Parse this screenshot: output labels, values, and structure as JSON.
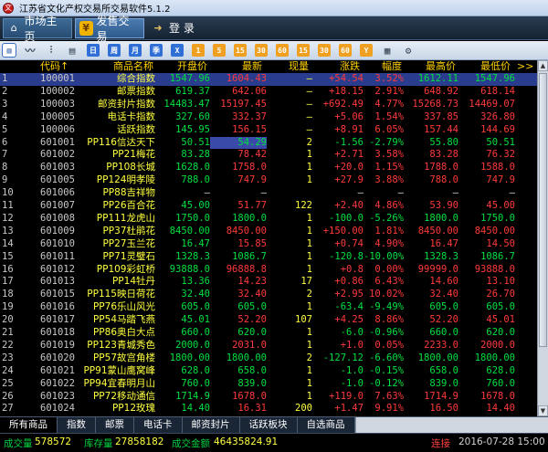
{
  "window": {
    "title": "江苏省文化产权交易所交易软件5.1.2",
    "logo": "文"
  },
  "top_tabs": [
    {
      "label": "市场主页",
      "icon": "home-icon"
    },
    {
      "label": "发售交易",
      "icon": "yen-icon"
    },
    {
      "label": "登 录",
      "icon": "login-icon"
    }
  ],
  "toolbar": {
    "buttons": [
      {
        "name": "kline-chart-icon",
        "glyph": "▥",
        "style": "sel"
      },
      {
        "name": "line-chart-icon",
        "glyph": "〰",
        "style": "plain"
      },
      {
        "name": "candles-icon",
        "glyph": "⫶",
        "style": "plain"
      },
      {
        "name": "list-icon",
        "glyph": "▤",
        "style": "plain"
      },
      {
        "name": "day-button",
        "glyph": "日",
        "style": "blue"
      },
      {
        "name": "week-button",
        "glyph": "周",
        "style": "blue"
      },
      {
        "name": "month-button",
        "glyph": "月",
        "style": "blue"
      },
      {
        "name": "season-button",
        "glyph": "季",
        "style": "blue"
      },
      {
        "name": "x-button",
        "glyph": "X",
        "style": "blue"
      },
      {
        "name": "period-1-button",
        "glyph": "1",
        "style": "orange"
      },
      {
        "name": "period-5-button",
        "glyph": "5",
        "style": "orange"
      },
      {
        "name": "period-15-button",
        "glyph": "15",
        "style": "orange"
      },
      {
        "name": "period-30-button",
        "glyph": "30",
        "style": "orange"
      },
      {
        "name": "period-60-button",
        "glyph": "60",
        "style": "orange"
      },
      {
        "name": "period-15b-button",
        "glyph": "15",
        "style": "orange"
      },
      {
        "name": "period-30b-button",
        "glyph": "30",
        "style": "orange"
      },
      {
        "name": "period-60b-button",
        "glyph": "60",
        "style": "orange"
      },
      {
        "name": "y-button",
        "glyph": "Y",
        "style": "orange"
      },
      {
        "name": "sheet-icon",
        "glyph": "▦",
        "style": "plain"
      },
      {
        "name": "gear-icon",
        "glyph": "⚙",
        "style": "plain"
      }
    ]
  },
  "columns": {
    "code": "代码↑",
    "name": "商品名称",
    "open": "开盘价",
    "last": "最新",
    "vol": "现量",
    "chg": "涨跌",
    "pct": "幅度",
    "high": "最高价",
    "low": "最低价",
    "more": ">>"
  },
  "colors": {
    "up": "#ff3a3a",
    "down": "#00e040",
    "flat": "#d8d8d8",
    "header": "#ffd000"
  },
  "rows": [
    [
      "1",
      "100001",
      "综合指数",
      "1547.96",
      "1604.43",
      "—",
      "+54.54",
      "3.52%",
      "1612.11",
      "1547.96",
      "u"
    ],
    [
      "2",
      "100002",
      "邮票指数",
      "619.37",
      "642.06",
      "—",
      "+18.15",
      "2.91%",
      "648.92",
      "618.14",
      "u"
    ],
    [
      "3",
      "100003",
      "邮资封片指数",
      "14483.47",
      "15197.45",
      "—",
      "+692.49",
      "4.77%",
      "15268.73",
      "14469.07",
      "u"
    ],
    [
      "4",
      "100005",
      "电话卡指数",
      "327.60",
      "332.37",
      "—",
      "+5.06",
      "1.54%",
      "337.85",
      "326.80",
      "u"
    ],
    [
      "5",
      "100006",
      "话跃指数",
      "145.95",
      "156.15",
      "—",
      "+8.91",
      "6.05%",
      "157.44",
      "144.69",
      "u"
    ],
    [
      "6",
      "601001",
      "PP116信达天下",
      "50.51",
      "54.29",
      "2",
      "-1.56",
      "-2.79%",
      "55.80",
      "50.51",
      "d"
    ],
    [
      "7",
      "601002",
      "PP21梅花",
      "83.28",
      "78.42",
      "1",
      "+2.71",
      "3.58%",
      "83.28",
      "76.32",
      "u"
    ],
    [
      "8",
      "601003",
      "PP108长城",
      "1628.0",
      "1758.0",
      "1",
      "+20.0",
      "1.15%",
      "1788.0",
      "1588.0",
      "u"
    ],
    [
      "9",
      "601005",
      "PP124明孝陵",
      "788.0",
      "747.9",
      "1",
      "+27.9",
      "3.88%",
      "788.0",
      "747.9",
      "u"
    ],
    [
      "10",
      "601006",
      "PP88吉祥物",
      "—",
      "—",
      "",
      "—",
      "—",
      "—",
      "—",
      "f"
    ],
    [
      "11",
      "601007",
      "PP26百合花",
      "45.00",
      "51.77",
      "122",
      "+2.40",
      "4.86%",
      "53.90",
      "45.00",
      "u"
    ],
    [
      "12",
      "601008",
      "PP111龙虎山",
      "1750.0",
      "1800.0",
      "1",
      "-100.0",
      "-5.26%",
      "1800.0",
      "1750.0",
      "d"
    ],
    [
      "13",
      "601009",
      "PP37杜鹃花",
      "8450.00",
      "8450.00",
      "1",
      "+150.00",
      "1.81%",
      "8450.00",
      "8450.00",
      "u"
    ],
    [
      "14",
      "601010",
      "PP27玉兰花",
      "16.47",
      "15.85",
      "1",
      "+0.74",
      "4.90%",
      "16.47",
      "14.50",
      "u"
    ],
    [
      "15",
      "601011",
      "PP71灵璧石",
      "1328.3",
      "1086.7",
      "1",
      "-120.8",
      "-10.00%",
      "1328.3",
      "1086.7",
      "d"
    ],
    [
      "16",
      "601012",
      "PP109彩虹桥",
      "93888.0",
      "96888.8",
      "1",
      "+0.8",
      "0.00%",
      "99999.0",
      "93888.0",
      "u"
    ],
    [
      "17",
      "601013",
      "PP14牡丹",
      "13.36",
      "14.23",
      "17",
      "+0.86",
      "6.43%",
      "14.60",
      "13.10",
      "u"
    ],
    [
      "18",
      "601015",
      "PP115映日荷花",
      "32.40",
      "32.40",
      "2",
      "+2.95",
      "10.02%",
      "32.40",
      "26.70",
      "u"
    ],
    [
      "19",
      "601016",
      "PP76乐山风光",
      "605.0",
      "605.0",
      "1",
      "-63.4",
      "-9.49%",
      "605.0",
      "605.0",
      "d"
    ],
    [
      "20",
      "601017",
      "PP54马踏飞燕",
      "45.01",
      "52.20",
      "107",
      "+4.25",
      "8.86%",
      "52.20",
      "45.01",
      "u"
    ],
    [
      "21",
      "601018",
      "PP86奥白大点",
      "660.0",
      "620.0",
      "1",
      "-6.0",
      "-0.96%",
      "660.0",
      "620.0",
      "d"
    ],
    [
      "22",
      "601019",
      "PP123青城秀色",
      "2000.0",
      "2031.0",
      "1",
      "+1.0",
      "0.05%",
      "2233.0",
      "2000.0",
      "u"
    ],
    [
      "23",
      "601020",
      "PP57故宫角楼",
      "1800.00",
      "1800.00",
      "2",
      "-127.12",
      "-6.60%",
      "1800.00",
      "1800.00",
      "d"
    ],
    [
      "24",
      "601021",
      "PP91蒙山鹰窝峰",
      "628.0",
      "658.0",
      "1",
      "-1.0",
      "-0.15%",
      "658.0",
      "628.0",
      "d"
    ],
    [
      "25",
      "601022",
      "PP94宜春明月山",
      "760.0",
      "839.0",
      "1",
      "-1.0",
      "-0.12%",
      "839.0",
      "760.0",
      "d"
    ],
    [
      "26",
      "601023",
      "PP72移动通信",
      "1714.9",
      "1678.0",
      "1",
      "+119.0",
      "7.63%",
      "1714.9",
      "1678.0",
      "u"
    ],
    [
      "27",
      "601024",
      "PP12玫瑰",
      "14.40",
      "16.31",
      "200",
      "+1.47",
      "9.91%",
      "16.50",
      "14.40",
      "u"
    ]
  ],
  "bottom_tabs": [
    "所有商品",
    "指数",
    "邮票",
    "电话卡",
    "邮资封片",
    "话跃板块",
    "自选商品"
  ],
  "status": {
    "deal_vol_label": "成交量",
    "deal_vol": "578572",
    "stock_label": "库存量",
    "stock": "27858182",
    "amount_label": "成交金额",
    "amount": "46435824.91",
    "connection": "连接",
    "datetime": "2016-07-28 15:00"
  }
}
